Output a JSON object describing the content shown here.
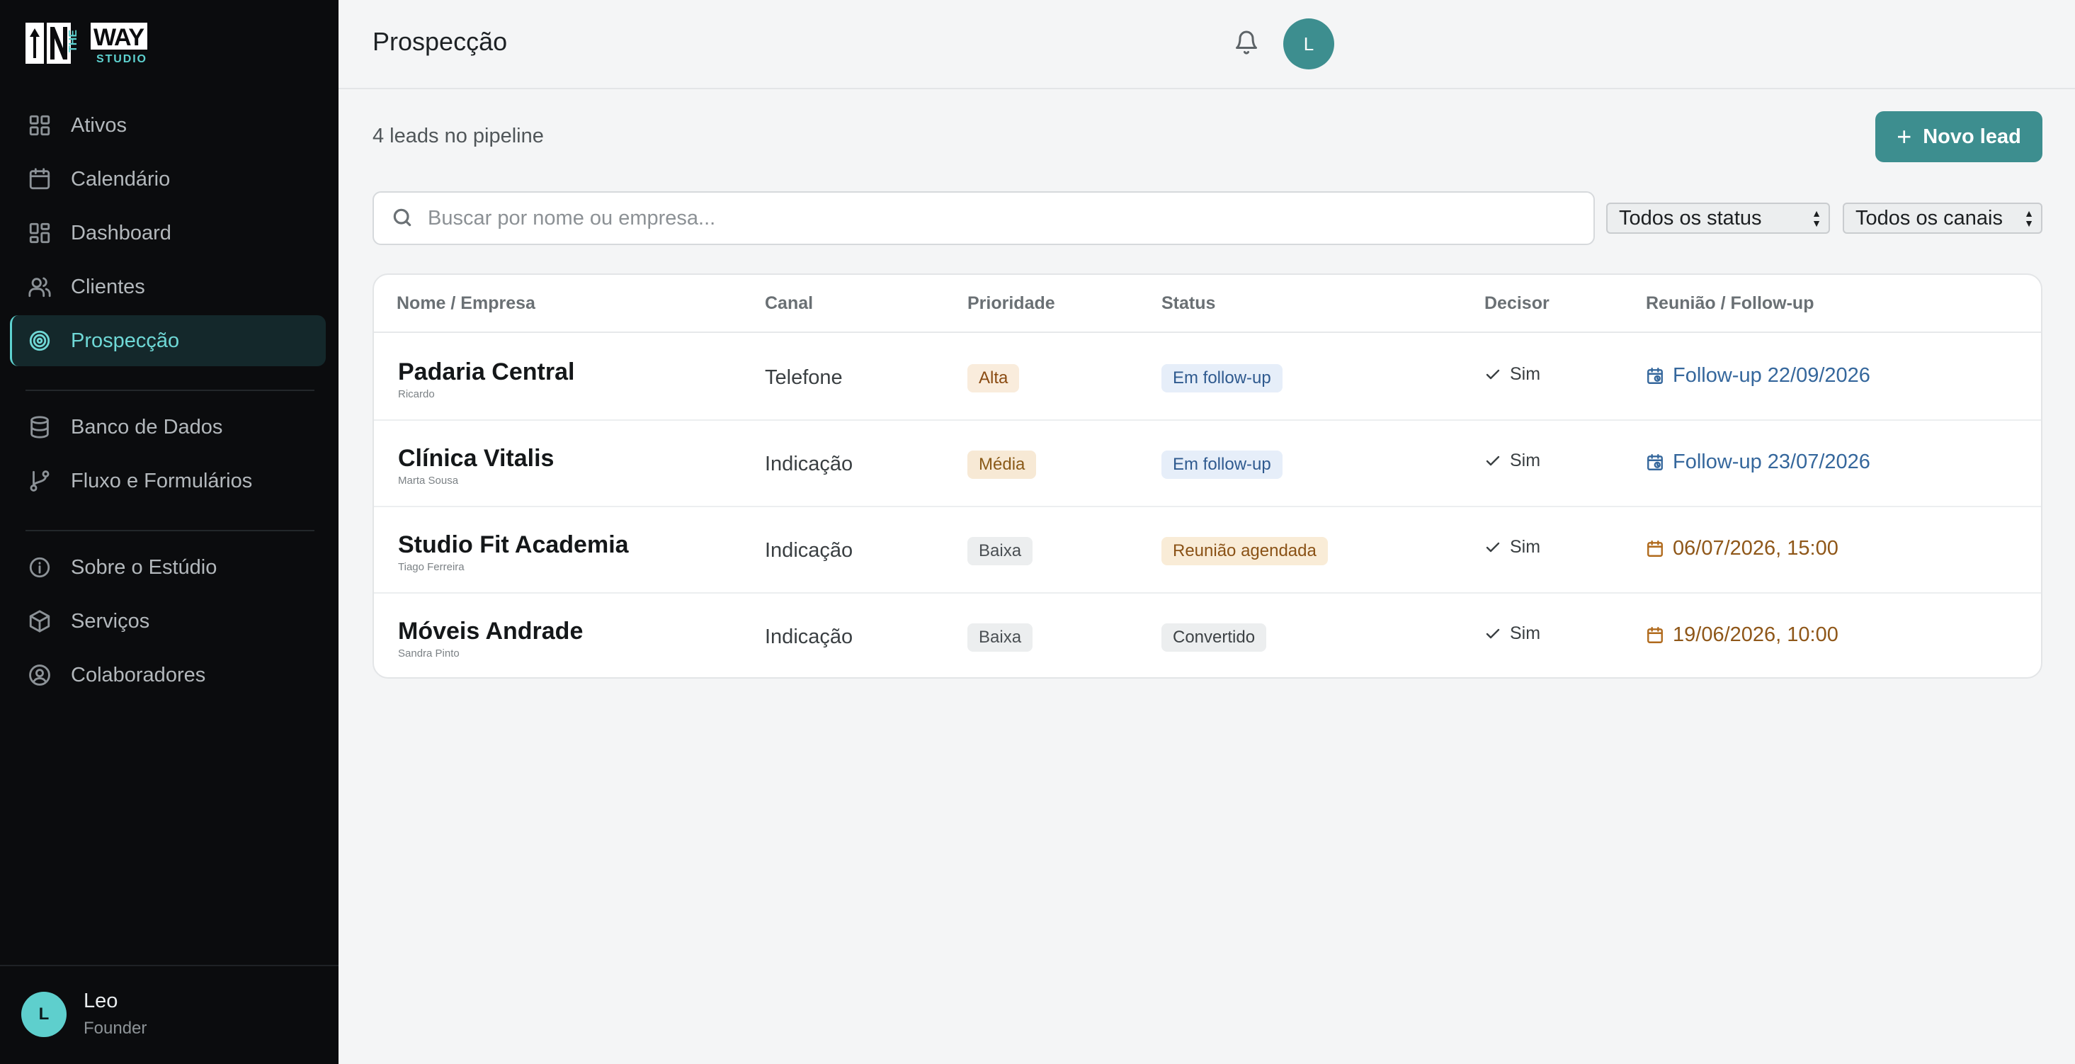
{
  "brand": {
    "logo_text": "ON THE WAY STUDIO",
    "accent": "#5ed2d0",
    "primary": "#3d8e8f"
  },
  "sidebar": {
    "items": [
      {
        "label": "Ativos",
        "icon": "grid-icon"
      },
      {
        "label": "Calendário",
        "icon": "calendar-icon"
      },
      {
        "label": "Dashboard",
        "icon": "dashboard-icon"
      },
      {
        "label": "Clientes",
        "icon": "users-icon"
      },
      {
        "label": "Prospecção",
        "icon": "target-icon",
        "active": true
      },
      {
        "label": "Banco de Dados",
        "icon": "database-icon"
      },
      {
        "label": "Fluxo e Formulários",
        "icon": "git-branch-icon"
      },
      {
        "label": "Sobre o Estúdio",
        "icon": "info-icon"
      },
      {
        "label": "Serviços",
        "icon": "box-icon"
      },
      {
        "label": "Colaboradores",
        "icon": "user-circle-icon"
      }
    ],
    "user": {
      "initial": "L",
      "name": "Leo",
      "role": "Founder"
    }
  },
  "header": {
    "title": "Prospecção",
    "avatar_initial": "L"
  },
  "toolbar": {
    "leads_count": "4 leads no pipeline",
    "new_lead_label": "Novo lead",
    "search_placeholder": "Buscar por nome ou empresa...",
    "status_filter": "Todos os status",
    "channel_filter": "Todos os canais"
  },
  "table": {
    "columns": [
      "Nome / Empresa",
      "Canal",
      "Prioridade",
      "Status",
      "Decisor",
      "Reunião / Follow-up"
    ],
    "rows": [
      {
        "name": "Padaria Central",
        "contact": "Ricardo",
        "canal": "Telefone",
        "prioridade": "Alta",
        "status": "Em follow-up",
        "decisor": "Sim",
        "reuniao": "Follow-up 22/09/2026"
      },
      {
        "name": "Clínica Vitalis",
        "contact": "Marta Sousa",
        "canal": "Indicação",
        "prioridade": "Média",
        "status": "Em follow-up",
        "decisor": "Sim",
        "reuniao": "Follow-up 23/07/2026"
      },
      {
        "name": "Studio Fit Academia",
        "contact": "Tiago Ferreira",
        "canal": "Indicação",
        "prioridade": "Baixa",
        "status": "Reunião agendada",
        "decisor": "Sim",
        "reuniao": "06/07/2026, 15:00"
      },
      {
        "name": "Móveis Andrade",
        "contact": "Sandra Pinto",
        "canal": "Indicação",
        "prioridade": "Baixa",
        "status": "Convertido",
        "decisor": "Sim",
        "reuniao": "19/06/2026, 10:00"
      }
    ]
  }
}
